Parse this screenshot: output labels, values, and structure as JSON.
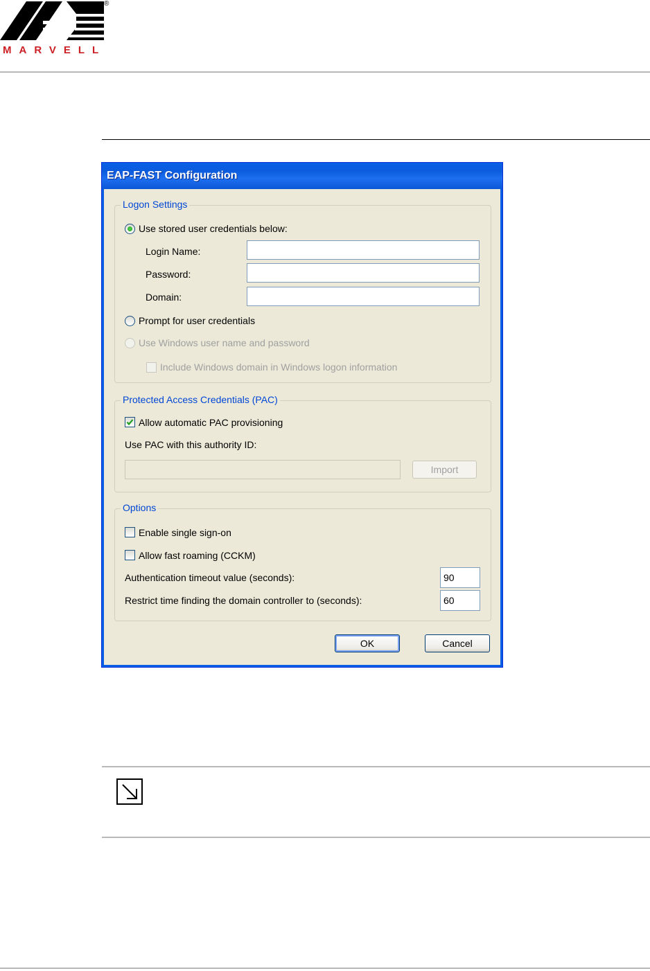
{
  "brand": {
    "name": "MARVELL",
    "reg_mark": "®"
  },
  "dialog": {
    "title": "EAP-FAST Configuration",
    "logon_settings": {
      "legend": "Logon Settings",
      "opt_stored": "Use stored user credentials below:",
      "login_label": "Login Name:",
      "login_value": "",
      "password_label": "Password:",
      "password_value": "",
      "domain_label": "Domain:",
      "domain_value": "",
      "opt_prompt": "Prompt for user credentials",
      "opt_windows": "Use Windows user name and password",
      "include_domain": "Include Windows domain in Windows logon information"
    },
    "pac": {
      "legend": "Protected Access Credentials (PAC)",
      "allow_auto": "Allow automatic PAC provisioning",
      "authority_label": "Use PAC with this authority ID:",
      "authority_value": "",
      "import_label": "Import"
    },
    "options": {
      "legend": "Options",
      "single_sign_on": "Enable single sign-on",
      "fast_roaming": "Allow fast roaming (CCKM)",
      "auth_timeout_label": "Authentication timeout value (seconds):",
      "auth_timeout_value": "90",
      "restrict_label": "Restrict time finding the domain controller to (seconds):",
      "restrict_value": "60"
    },
    "ok_label": "OK",
    "cancel_label": "Cancel"
  },
  "colors": {
    "title_bar": "#0a5fe8",
    "dialog_face": "#ece9d8",
    "legend_text": "#0046d5",
    "brand_red": "#cc1f24"
  },
  "icons": {
    "note": "note-arrow-icon"
  }
}
